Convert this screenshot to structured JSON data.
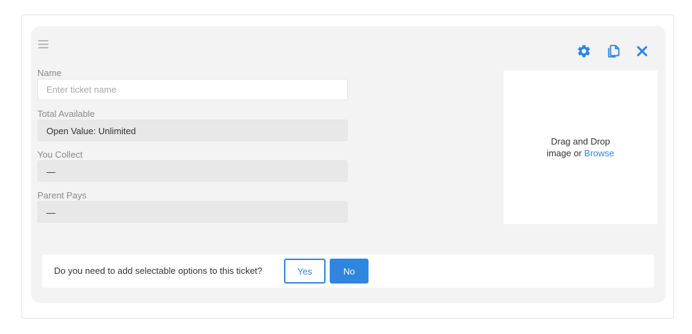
{
  "form": {
    "name_label": "Name",
    "name_placeholder": "Enter ticket name",
    "name_value": "",
    "total_available_label": "Total Available",
    "total_available_value": "Open Value: Unlimited",
    "you_collect_label": "You Collect",
    "you_collect_value": "—",
    "parent_pays_label": "Parent Pays",
    "parent_pays_value": "—"
  },
  "toolbar": {
    "icons": [
      "gear-icon",
      "copy-icon",
      "close-icon"
    ],
    "accent_color": "#2e86de"
  },
  "dropzone": {
    "line1": "Drag and Drop",
    "line2_prefix": "image or ",
    "browse_label": "Browse"
  },
  "options_prompt": {
    "question": "Do you need to add selectable options to this ticket?",
    "yes_label": "Yes",
    "no_label": "No"
  }
}
